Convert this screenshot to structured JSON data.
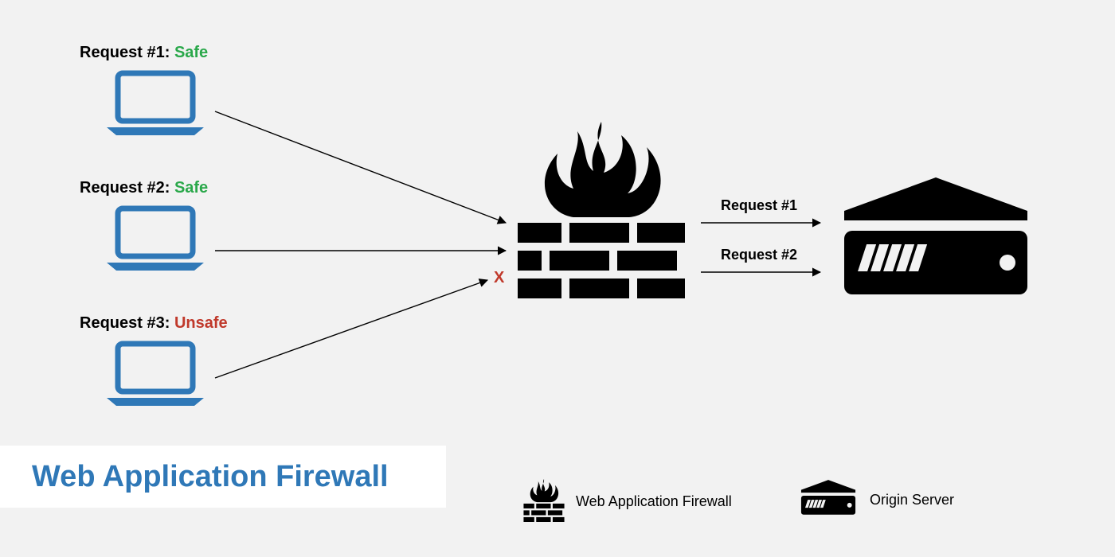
{
  "title": "Web Application Firewall",
  "requests": [
    {
      "label": "Request #1:",
      "status": "Safe",
      "status_class": "safe"
    },
    {
      "label": "Request #2:",
      "status": "Safe",
      "status_class": "safe"
    },
    {
      "label": "Request #3:",
      "status": "Unsafe",
      "status_class": "unsafe"
    }
  ],
  "passed": [
    {
      "label": "Request #1"
    },
    {
      "label": "Request #2"
    }
  ],
  "block_mark": "X",
  "legend": {
    "firewall": "Web Application Firewall",
    "server": "Origin Server"
  },
  "colors": {
    "laptop": "#2f78b7",
    "safe": "#2aa84a",
    "unsafe": "#c0392b",
    "title": "#2f78b7"
  }
}
